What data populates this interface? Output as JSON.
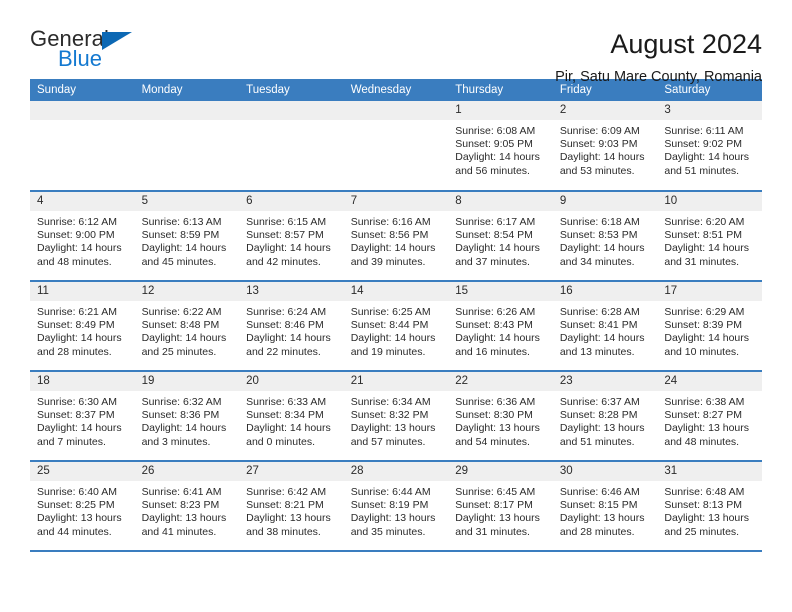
{
  "brand": {
    "name_dark": "General",
    "name_blue": "Blue",
    "accent_color": "#1479d0",
    "triangle_color": "#0c68b4"
  },
  "header": {
    "title": "August 2024",
    "subtitle": "Pir, Satu Mare County, Romania"
  },
  "calendar": {
    "header_bg": "#3a7dbf",
    "daynum_bg": "#efefef",
    "weekdays": [
      "Sunday",
      "Monday",
      "Tuesday",
      "Wednesday",
      "Thursday",
      "Friday",
      "Saturday"
    ],
    "weeks": [
      [
        {
          "day": "",
          "empty": true
        },
        {
          "day": "",
          "empty": true
        },
        {
          "day": "",
          "empty": true
        },
        {
          "day": "",
          "empty": true
        },
        {
          "day": "1",
          "sunrise": "Sunrise: 6:08 AM",
          "sunset": "Sunset: 9:05 PM",
          "daylight1": "Daylight: 14 hours",
          "daylight2": "and 56 minutes."
        },
        {
          "day": "2",
          "sunrise": "Sunrise: 6:09 AM",
          "sunset": "Sunset: 9:03 PM",
          "daylight1": "Daylight: 14 hours",
          "daylight2": "and 53 minutes."
        },
        {
          "day": "3",
          "sunrise": "Sunrise: 6:11 AM",
          "sunset": "Sunset: 9:02 PM",
          "daylight1": "Daylight: 14 hours",
          "daylight2": "and 51 minutes."
        }
      ],
      [
        {
          "day": "4",
          "sunrise": "Sunrise: 6:12 AM",
          "sunset": "Sunset: 9:00 PM",
          "daylight1": "Daylight: 14 hours",
          "daylight2": "and 48 minutes."
        },
        {
          "day": "5",
          "sunrise": "Sunrise: 6:13 AM",
          "sunset": "Sunset: 8:59 PM",
          "daylight1": "Daylight: 14 hours",
          "daylight2": "and 45 minutes."
        },
        {
          "day": "6",
          "sunrise": "Sunrise: 6:15 AM",
          "sunset": "Sunset: 8:57 PM",
          "daylight1": "Daylight: 14 hours",
          "daylight2": "and 42 minutes."
        },
        {
          "day": "7",
          "sunrise": "Sunrise: 6:16 AM",
          "sunset": "Sunset: 8:56 PM",
          "daylight1": "Daylight: 14 hours",
          "daylight2": "and 39 minutes."
        },
        {
          "day": "8",
          "sunrise": "Sunrise: 6:17 AM",
          "sunset": "Sunset: 8:54 PM",
          "daylight1": "Daylight: 14 hours",
          "daylight2": "and 37 minutes."
        },
        {
          "day": "9",
          "sunrise": "Sunrise: 6:18 AM",
          "sunset": "Sunset: 8:53 PM",
          "daylight1": "Daylight: 14 hours",
          "daylight2": "and 34 minutes."
        },
        {
          "day": "10",
          "sunrise": "Sunrise: 6:20 AM",
          "sunset": "Sunset: 8:51 PM",
          "daylight1": "Daylight: 14 hours",
          "daylight2": "and 31 minutes."
        }
      ],
      [
        {
          "day": "11",
          "sunrise": "Sunrise: 6:21 AM",
          "sunset": "Sunset: 8:49 PM",
          "daylight1": "Daylight: 14 hours",
          "daylight2": "and 28 minutes."
        },
        {
          "day": "12",
          "sunrise": "Sunrise: 6:22 AM",
          "sunset": "Sunset: 8:48 PM",
          "daylight1": "Daylight: 14 hours",
          "daylight2": "and 25 minutes."
        },
        {
          "day": "13",
          "sunrise": "Sunrise: 6:24 AM",
          "sunset": "Sunset: 8:46 PM",
          "daylight1": "Daylight: 14 hours",
          "daylight2": "and 22 minutes."
        },
        {
          "day": "14",
          "sunrise": "Sunrise: 6:25 AM",
          "sunset": "Sunset: 8:44 PM",
          "daylight1": "Daylight: 14 hours",
          "daylight2": "and 19 minutes."
        },
        {
          "day": "15",
          "sunrise": "Sunrise: 6:26 AM",
          "sunset": "Sunset: 8:43 PM",
          "daylight1": "Daylight: 14 hours",
          "daylight2": "and 16 minutes."
        },
        {
          "day": "16",
          "sunrise": "Sunrise: 6:28 AM",
          "sunset": "Sunset: 8:41 PM",
          "daylight1": "Daylight: 14 hours",
          "daylight2": "and 13 minutes."
        },
        {
          "day": "17",
          "sunrise": "Sunrise: 6:29 AM",
          "sunset": "Sunset: 8:39 PM",
          "daylight1": "Daylight: 14 hours",
          "daylight2": "and 10 minutes."
        }
      ],
      [
        {
          "day": "18",
          "sunrise": "Sunrise: 6:30 AM",
          "sunset": "Sunset: 8:37 PM",
          "daylight1": "Daylight: 14 hours",
          "daylight2": "and 7 minutes."
        },
        {
          "day": "19",
          "sunrise": "Sunrise: 6:32 AM",
          "sunset": "Sunset: 8:36 PM",
          "daylight1": "Daylight: 14 hours",
          "daylight2": "and 3 minutes."
        },
        {
          "day": "20",
          "sunrise": "Sunrise: 6:33 AM",
          "sunset": "Sunset: 8:34 PM",
          "daylight1": "Daylight: 14 hours",
          "daylight2": "and 0 minutes."
        },
        {
          "day": "21",
          "sunrise": "Sunrise: 6:34 AM",
          "sunset": "Sunset: 8:32 PM",
          "daylight1": "Daylight: 13 hours",
          "daylight2": "and 57 minutes."
        },
        {
          "day": "22",
          "sunrise": "Sunrise: 6:36 AM",
          "sunset": "Sunset: 8:30 PM",
          "daylight1": "Daylight: 13 hours",
          "daylight2": "and 54 minutes."
        },
        {
          "day": "23",
          "sunrise": "Sunrise: 6:37 AM",
          "sunset": "Sunset: 8:28 PM",
          "daylight1": "Daylight: 13 hours",
          "daylight2": "and 51 minutes."
        },
        {
          "day": "24",
          "sunrise": "Sunrise: 6:38 AM",
          "sunset": "Sunset: 8:27 PM",
          "daylight1": "Daylight: 13 hours",
          "daylight2": "and 48 minutes."
        }
      ],
      [
        {
          "day": "25",
          "sunrise": "Sunrise: 6:40 AM",
          "sunset": "Sunset: 8:25 PM",
          "daylight1": "Daylight: 13 hours",
          "daylight2": "and 44 minutes."
        },
        {
          "day": "26",
          "sunrise": "Sunrise: 6:41 AM",
          "sunset": "Sunset: 8:23 PM",
          "daylight1": "Daylight: 13 hours",
          "daylight2": "and 41 minutes."
        },
        {
          "day": "27",
          "sunrise": "Sunrise: 6:42 AM",
          "sunset": "Sunset: 8:21 PM",
          "daylight1": "Daylight: 13 hours",
          "daylight2": "and 38 minutes."
        },
        {
          "day": "28",
          "sunrise": "Sunrise: 6:44 AM",
          "sunset": "Sunset: 8:19 PM",
          "daylight1": "Daylight: 13 hours",
          "daylight2": "and 35 minutes."
        },
        {
          "day": "29",
          "sunrise": "Sunrise: 6:45 AM",
          "sunset": "Sunset: 8:17 PM",
          "daylight1": "Daylight: 13 hours",
          "daylight2": "and 31 minutes."
        },
        {
          "day": "30",
          "sunrise": "Sunrise: 6:46 AM",
          "sunset": "Sunset: 8:15 PM",
          "daylight1": "Daylight: 13 hours",
          "daylight2": "and 28 minutes."
        },
        {
          "day": "31",
          "sunrise": "Sunrise: 6:48 AM",
          "sunset": "Sunset: 8:13 PM",
          "daylight1": "Daylight: 13 hours",
          "daylight2": "and 25 minutes."
        }
      ]
    ]
  }
}
